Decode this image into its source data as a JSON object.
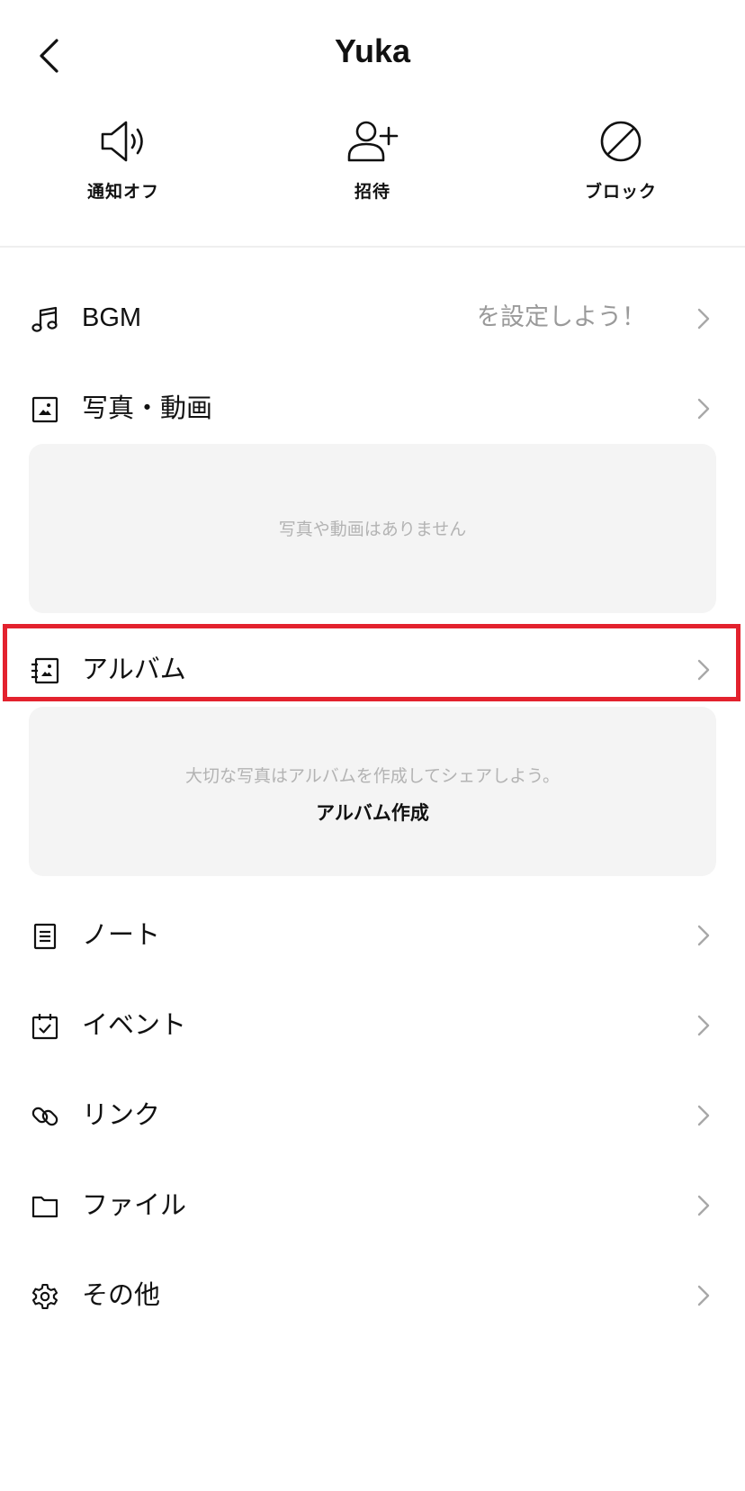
{
  "header": {
    "title": "Yuka",
    "back_icon": "chevron-left-icon"
  },
  "actions": [
    {
      "label": "通知オフ",
      "icon": "speaker-icon"
    },
    {
      "label": "招待",
      "icon": "add-person-icon"
    },
    {
      "label": "ブロック",
      "icon": "block-icon"
    }
  ],
  "menu": {
    "bgm": {
      "label": "BGM",
      "value": "BGMを設定しよう！"
    },
    "photos": {
      "label": "写真・動画",
      "empty_text": "写真や動画はありません"
    },
    "album": {
      "label": "アルバム",
      "empty_text": "大切な写真はアルバムを作成してシェアしよう。",
      "create_label": "アルバム作成"
    },
    "note": {
      "label": "ノート"
    },
    "event": {
      "label": "イベント"
    },
    "link": {
      "label": "リンク"
    },
    "file": {
      "label": "ファイル"
    },
    "other": {
      "label": "その他"
    }
  },
  "colors": {
    "highlight": "#e3222e",
    "card_bg": "#f4f4f4",
    "muted_text": "#b3b3b3"
  }
}
